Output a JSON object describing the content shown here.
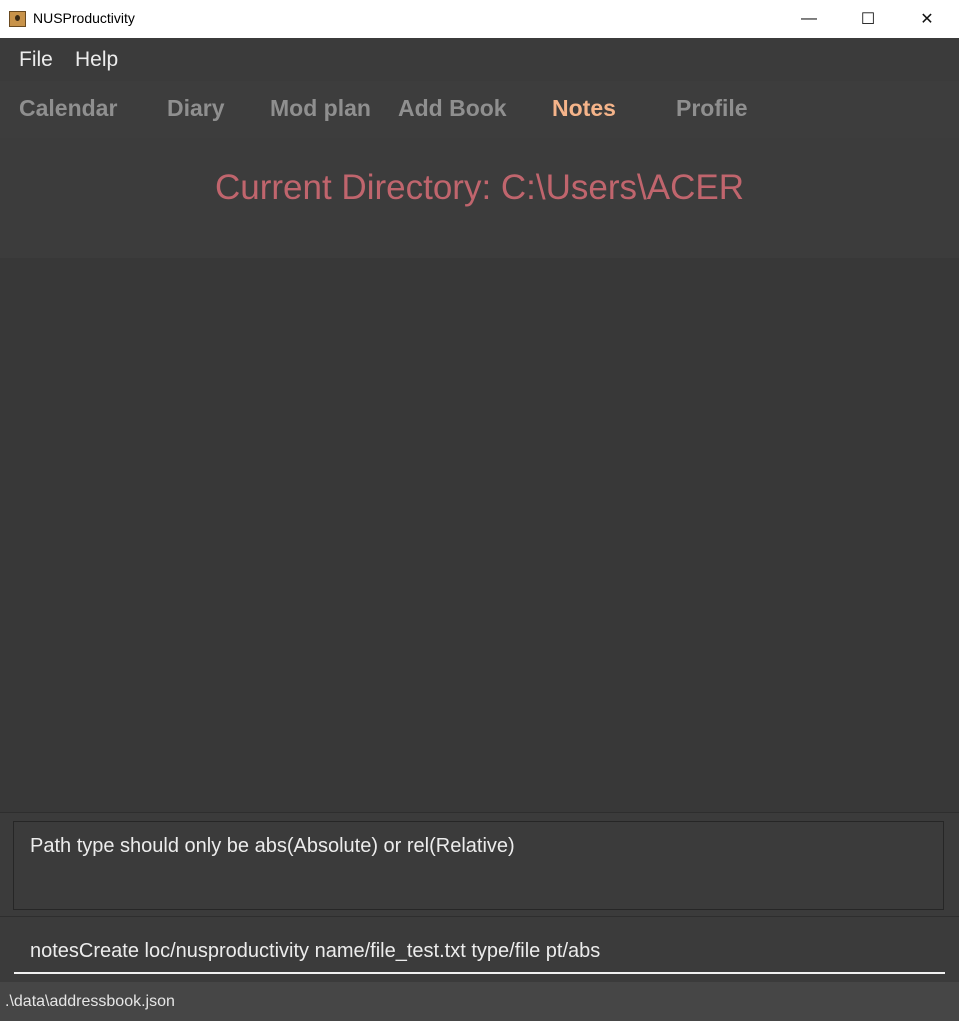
{
  "window": {
    "title": "NUSProductivity",
    "controls": {
      "minimize": "—",
      "maximize": "☐",
      "close": "✕"
    }
  },
  "menu": {
    "items": [
      "File",
      "Help"
    ]
  },
  "tabs": [
    {
      "label": "Calendar",
      "active": false
    },
    {
      "label": "Diary",
      "active": false
    },
    {
      "label": "Mod plan",
      "active": false
    },
    {
      "label": "Add Book",
      "active": false
    },
    {
      "label": "Notes",
      "active": true
    },
    {
      "label": "Profile",
      "active": false
    }
  ],
  "notes": {
    "current_directory": "Current Directory: C:\\Users\\ACER"
  },
  "result": {
    "message": "Path type should only be abs(Absolute) or rel(Relative)"
  },
  "command": {
    "value": "notesCreate loc/nusproductivity name/file_test.txt type/file pt/abs"
  },
  "status": {
    "file_path": ".\\data\\addressbook.json"
  },
  "colors": {
    "active_tab": "#f5b48a",
    "directory_text": "#c0656d",
    "background": "#383838"
  }
}
